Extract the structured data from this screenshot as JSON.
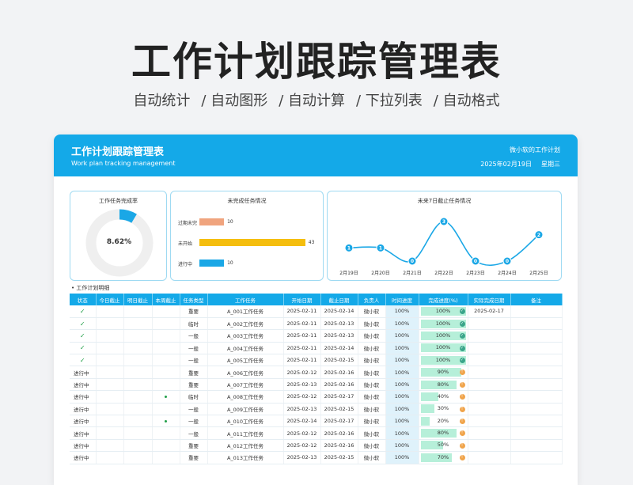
{
  "hero": {
    "title": "工作计划跟踪管理表",
    "features": [
      "自动统计",
      "/ 自动图形",
      "/ 自动计算",
      "/ 下拉列表",
      "/ 自动格式"
    ]
  },
  "card": {
    "title": "工作计划跟踪管理表",
    "subtitle": "Work plan tracking management",
    "owner": "微小软的工作计划",
    "date": "2025年02月19日",
    "weekday": "星期三"
  },
  "colors": {
    "accent": "#14a9e8",
    "orange": "#f0a47e",
    "yellow": "#f5be0e",
    "blue": "#1aa7e6",
    "progress": "#b6efd9"
  },
  "chart_data": [
    {
      "type": "pie",
      "title": "工作任务完成率",
      "values": [
        8.62,
        91.38
      ],
      "center_label": "8.62%"
    },
    {
      "type": "bar",
      "title": "未完成任务情况",
      "categories": [
        "过期未完",
        "未开始",
        "进行中"
      ],
      "values": [
        10,
        43,
        10
      ],
      "colors": [
        "#f0a47e",
        "#f5be0e",
        "#1aa7e6"
      ]
    },
    {
      "type": "line",
      "title": "未来7日截止任务情况",
      "categories": [
        "2月19日",
        "2月20日",
        "2月21日",
        "2月22日",
        "2月23日",
        "2月24日",
        "2月25日"
      ],
      "values": [
        1,
        1,
        0,
        3,
        0,
        0,
        2
      ]
    }
  ],
  "table": {
    "section_label": "• 工作计划明细",
    "headers": [
      "状态",
      "今日截止",
      "明日截止",
      "本周截止",
      "任务类型",
      "工作任务",
      "开始日期",
      "截止日期",
      "负责人",
      "时间进度",
      "完成进度(%)",
      "实际完成日期",
      "备注"
    ],
    "rows": [
      {
        "status": "✓",
        "done": true,
        "week": "",
        "type": "重要",
        "task": "A_001工作任务",
        "start": "2025-02-11",
        "end": "2025-02-14",
        "owner": "微小软",
        "tp": "100%",
        "cp": "100%",
        "cpv": 100,
        "icon": "✓",
        "iconkind": "ok",
        "actual": "2025-02-17"
      },
      {
        "status": "✓",
        "done": true,
        "week": "",
        "type": "临时",
        "task": "A_002工作任务",
        "start": "2025-02-11",
        "end": "2025-02-13",
        "owner": "微小软",
        "tp": "100%",
        "cp": "100%",
        "cpv": 100,
        "icon": "✓",
        "iconkind": "ok",
        "actual": ""
      },
      {
        "status": "✓",
        "done": true,
        "week": "",
        "type": "一般",
        "task": "A_003工作任务",
        "start": "2025-02-11",
        "end": "2025-02-13",
        "owner": "微小软",
        "tp": "100%",
        "cp": "100%",
        "cpv": 100,
        "icon": "✓",
        "iconkind": "ok",
        "actual": ""
      },
      {
        "status": "✓",
        "done": true,
        "week": "",
        "type": "一般",
        "task": "A_004工作任务",
        "start": "2025-02-11",
        "end": "2025-02-14",
        "owner": "微小软",
        "tp": "100%",
        "cp": "100%",
        "cpv": 100,
        "icon": "✓",
        "iconkind": "ok",
        "actual": ""
      },
      {
        "status": "✓",
        "done": true,
        "week": "",
        "type": "一般",
        "task": "A_005工作任务",
        "start": "2025-02-11",
        "end": "2025-02-15",
        "owner": "微小软",
        "tp": "100%",
        "cp": "100%",
        "cpv": 100,
        "icon": "✓",
        "iconkind": "ok",
        "actual": ""
      },
      {
        "status": "进行中",
        "done": false,
        "week": "",
        "type": "重要",
        "task": "A_006工作任务",
        "start": "2025-02-12",
        "end": "2025-02-16",
        "owner": "微小软",
        "tp": "100%",
        "cp": "90%",
        "cpv": 90,
        "icon": "!",
        "iconkind": "warn",
        "actual": ""
      },
      {
        "status": "进行中",
        "done": false,
        "week": "",
        "type": "重要",
        "task": "A_007工作任务",
        "start": "2025-02-13",
        "end": "2025-02-16",
        "owner": "微小软",
        "tp": "100%",
        "cp": "80%",
        "cpv": 80,
        "icon": "!",
        "iconkind": "warn",
        "actual": ""
      },
      {
        "status": "进行中",
        "done": false,
        "week": "•",
        "type": "临时",
        "task": "A_008工作任务",
        "start": "2025-02-12",
        "end": "2025-02-17",
        "owner": "微小软",
        "tp": "100%",
        "cp": "40%",
        "cpv": 40,
        "icon": "!",
        "iconkind": "warn",
        "actual": ""
      },
      {
        "status": "进行中",
        "done": false,
        "week": "",
        "type": "一般",
        "task": "A_009工作任务",
        "start": "2025-02-13",
        "end": "2025-02-15",
        "owner": "微小软",
        "tp": "100%",
        "cp": "30%",
        "cpv": 30,
        "icon": "!",
        "iconkind": "warn",
        "actual": ""
      },
      {
        "status": "进行中",
        "done": false,
        "week": "•",
        "type": "一般",
        "task": "A_010工作任务",
        "start": "2025-02-14",
        "end": "2025-02-17",
        "owner": "微小软",
        "tp": "100%",
        "cp": "20%",
        "cpv": 20,
        "icon": "!",
        "iconkind": "warn",
        "actual": ""
      },
      {
        "status": "进行中",
        "done": false,
        "week": "",
        "type": "一般",
        "task": "A_011工作任务",
        "start": "2025-02-12",
        "end": "2025-02-16",
        "owner": "微小软",
        "tp": "100%",
        "cp": "80%",
        "cpv": 80,
        "icon": "!",
        "iconkind": "warn",
        "actual": ""
      },
      {
        "status": "进行中",
        "done": false,
        "week": "",
        "type": "重要",
        "task": "A_012工作任务",
        "start": "2025-02-12",
        "end": "2025-02-16",
        "owner": "微小软",
        "tp": "100%",
        "cp": "50%",
        "cpv": 50,
        "icon": "!",
        "iconkind": "warn",
        "actual": ""
      },
      {
        "status": "进行中",
        "done": false,
        "week": "",
        "type": "重要",
        "task": "A_013工作任务",
        "start": "2025-02-13",
        "end": "2025-02-15",
        "owner": "微小软",
        "tp": "100%",
        "cp": "70%",
        "cpv": 70,
        "icon": "!",
        "iconkind": "warn",
        "actual": ""
      }
    ]
  }
}
